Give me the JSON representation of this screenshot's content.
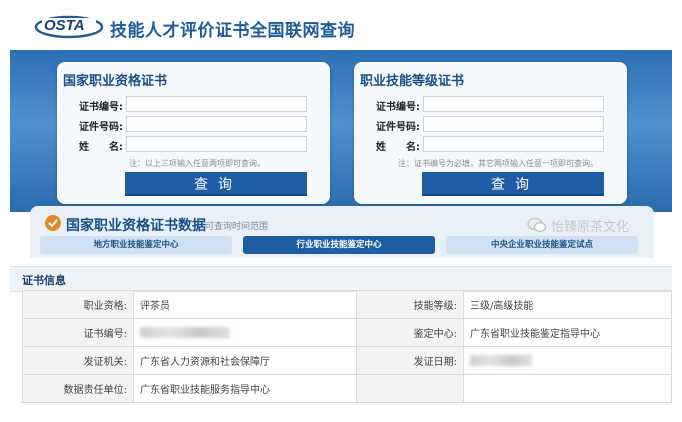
{
  "header": {
    "logo_text": "OSTA",
    "title": "技能人才评价证书全国联网查询"
  },
  "left_panel": {
    "title": "国家职业资格证书",
    "fields": [
      {
        "label": "证书编号:",
        "value": ""
      },
      {
        "label": "证件号码:",
        "value": ""
      },
      {
        "label": "姓　　名:",
        "value": ""
      }
    ],
    "note": "注：以上三项输入任意两项即可查询。",
    "button": "查询"
  },
  "right_panel": {
    "title": "职业技能等级证书",
    "fields": [
      {
        "label": "证书编号:",
        "value": ""
      },
      {
        "label": "证件号码:",
        "value": ""
      },
      {
        "label": "姓　　名:",
        "value": ""
      }
    ],
    "note": "注：证书编号为必填，其它两项输入任意一项即可查询。",
    "button": "查询"
  },
  "data_section": {
    "title": "国家职业资格证书数据",
    "subtitle": "可查询时间范围",
    "tabs": [
      "地方职业技能鉴定中心",
      "行业职业技能鉴定中心",
      "中央企业职业技能鉴定试点"
    ],
    "active_tab": 1
  },
  "watermark": "怡臻原茶文化",
  "cert_info": {
    "heading": "证书信息",
    "rows": [
      {
        "l1": "职业资格:",
        "v1": "评茶员",
        "l2": "技能等级:",
        "v2": "三级/高级技能"
      },
      {
        "l1": "证书编号:",
        "v1": "",
        "l2": "鉴定中心:",
        "v2": "广东省职业技能鉴定指导中心"
      },
      {
        "l1": "发证机关:",
        "v1": "广东省人力资源和社会保障厅",
        "l2": "发证日期:",
        "v2": ""
      },
      {
        "l1": "数据责任单位:",
        "v1": "广东省职业技能服务指导中心",
        "l2": "",
        "v2": ""
      }
    ]
  },
  "colors": {
    "brand_blue": "#1e5da4",
    "band_blue": "#2c6fb3",
    "title_blue": "#1a4f8a"
  }
}
